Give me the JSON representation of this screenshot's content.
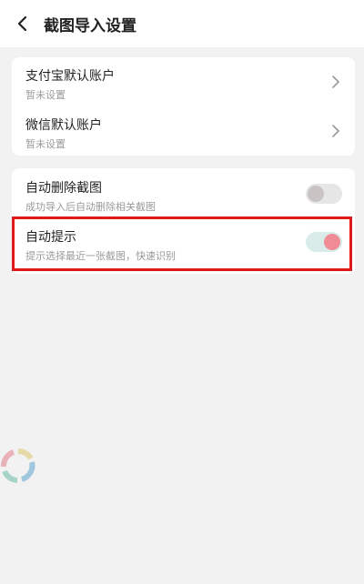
{
  "header": {
    "back_icon": "chevron-left-icon",
    "title": "截图导入设置"
  },
  "accounts": [
    {
      "label": "支付宝默认账户",
      "value": "暂未设置",
      "icon": "chevron-right-icon"
    },
    {
      "label": "微信默认账户",
      "value": "暂未设置",
      "icon": "chevron-right-icon"
    }
  ],
  "settings": [
    {
      "label": "自动删除截图",
      "description": "成功导入后自动删除相关截图",
      "enabled": false
    },
    {
      "label": "自动提示",
      "description": "提示选择最近一张截图，快速识别",
      "enabled": true
    }
  ],
  "colors": {
    "highlight_border": "#e01a1a",
    "toggle_off_track": "#e6e6e6",
    "toggle_off_knob": "#c9c3c3",
    "toggle_on_track": "#d9ece9",
    "toggle_on_knob": "#f08c96"
  }
}
